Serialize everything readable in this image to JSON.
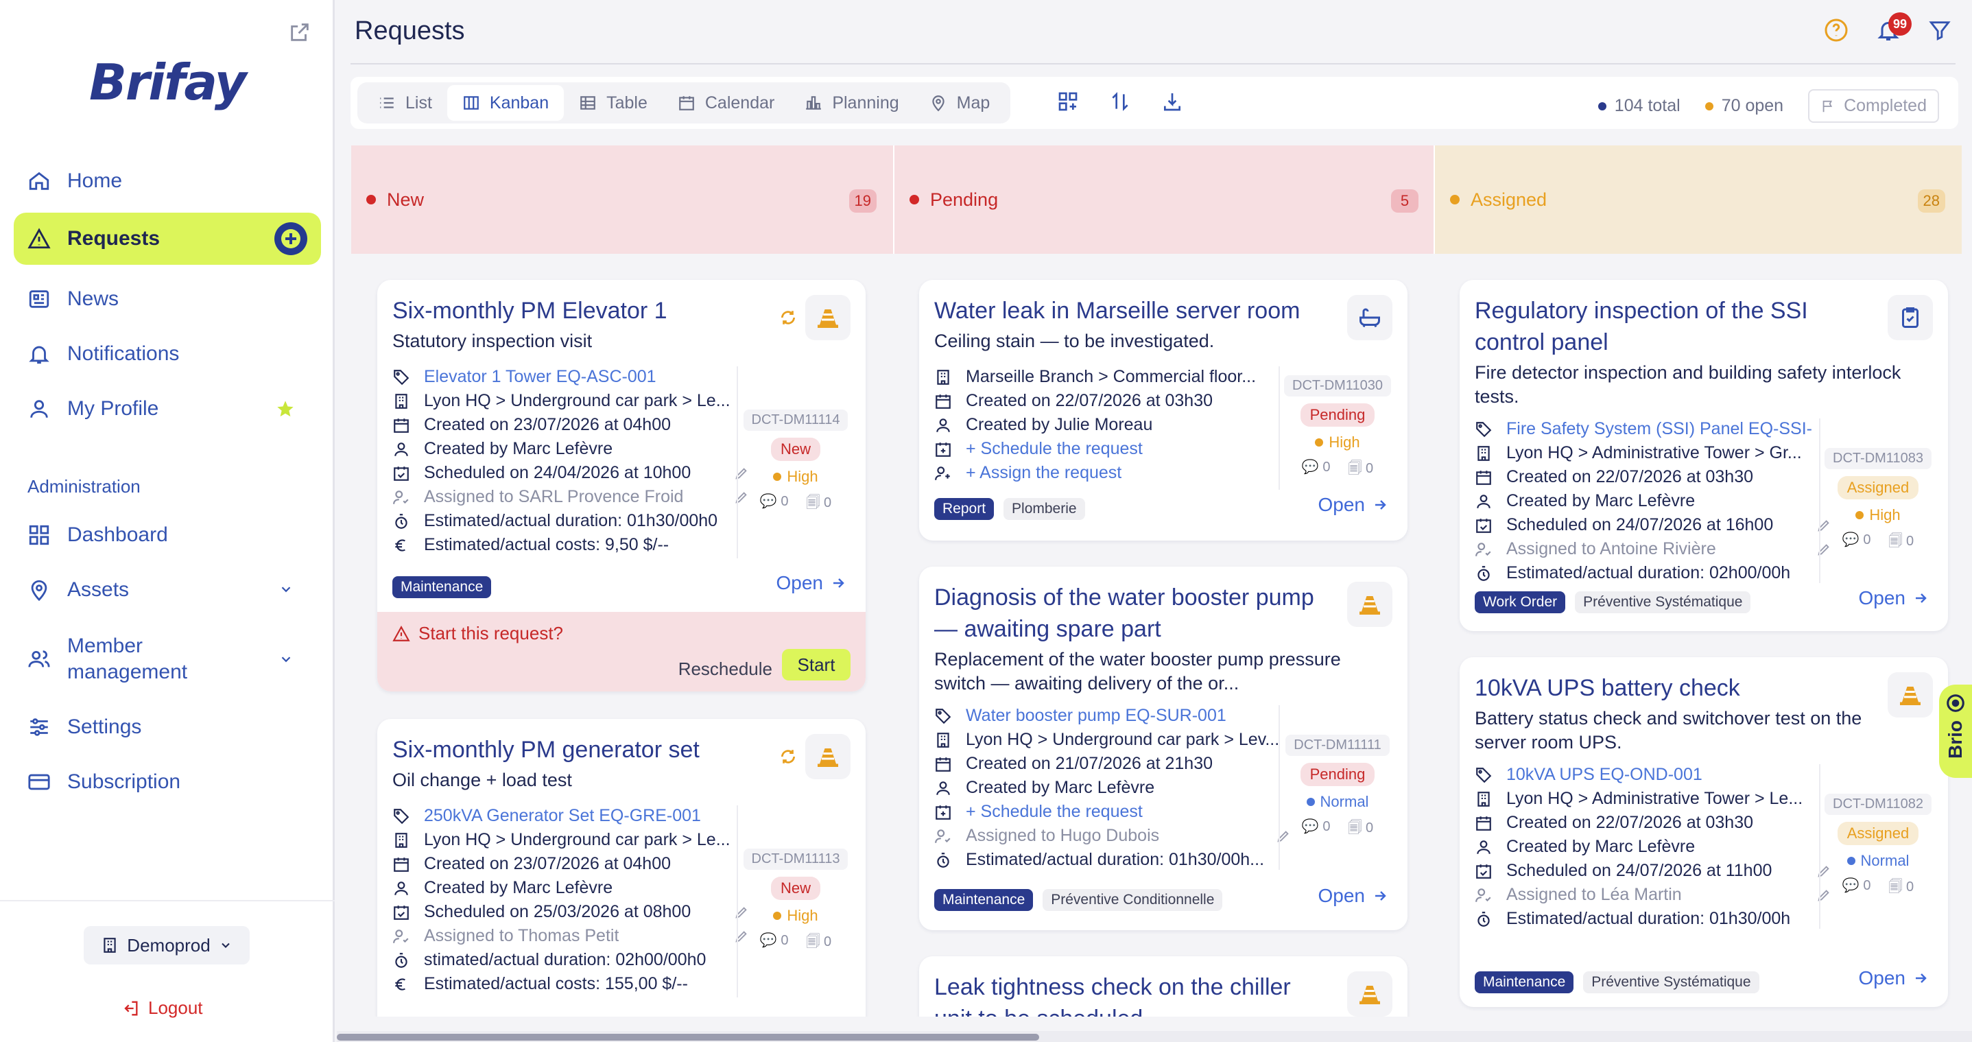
{
  "sidebar": {
    "logo": "Brifay",
    "nav": [
      {
        "label": "Home"
      },
      {
        "label": "Requests"
      },
      {
        "label": "News"
      },
      {
        "label": "Notifications"
      },
      {
        "label": "My Profile"
      }
    ],
    "admin_heading": "Administration",
    "admin_nav": [
      {
        "label": "Dashboard"
      },
      {
        "label": "Assets"
      },
      {
        "label": "Member management"
      },
      {
        "label": "Settings"
      },
      {
        "label": "Subscription"
      }
    ],
    "org": "Demoprod",
    "logout": "Logout"
  },
  "header": {
    "title": "Requests",
    "notif_count": "99"
  },
  "toolbar": {
    "views": [
      "List",
      "Kanban",
      "Table",
      "Calendar",
      "Planning",
      "Map"
    ],
    "active_view": "Kanban",
    "total": "104 total",
    "open": "70 open",
    "completed": "Completed"
  },
  "colors": {
    "accent": "#dcf55a",
    "brand": "#2a3a8c",
    "new": "#d32828",
    "assigned": "#e8a020"
  },
  "columns": [
    {
      "name": "New",
      "count": "19",
      "cards": [
        {
          "title": "Six-monthly PM Elevator 1",
          "subtitle": "Statutory inspection visit",
          "asset": "Elevator 1 Tower EQ-ASC-001",
          "location": "Lyon HQ > Underground car park > Le...",
          "created_on": "Created on 23/07/2026 at 04h00",
          "created_by": "Created by Marc Lefèvre",
          "scheduled": "Scheduled on 24/04/2026 at 10h00",
          "assigned": "Assigned to SARL Provence Froid",
          "duration": "Estimated/actual duration: 01h30/00h0",
          "costs": "Estimated/actual costs: 9,50 $/--",
          "ref": "DCT-DM11114",
          "status": "New",
          "priority": "High",
          "comments": "0",
          "attachments": "0",
          "tags": [
            "Maintenance"
          ],
          "open": "Open",
          "start_question": "Start this request?",
          "reschedule": "Reschedule",
          "start": "Start"
        },
        {
          "title": "Six-monthly PM generator set",
          "subtitle": "Oil change + load test",
          "asset": "250kVA Generator Set EQ-GRE-001",
          "location": "Lyon HQ > Underground car park > Le...",
          "created_on": "Created on 23/07/2026 at 04h00",
          "created_by": "Created by Marc Lefèvre",
          "scheduled": "Scheduled on 25/03/2026 at 08h00",
          "assigned": "Assigned to Thomas Petit",
          "duration": "stimated/actual duration: 02h00/00h0",
          "costs": "Estimated/actual costs: 155,00 $/--",
          "ref": "DCT-DM11113",
          "status": "New",
          "priority": "High",
          "comments": "0",
          "attachments": "0",
          "open": "Open"
        }
      ]
    },
    {
      "name": "Pending",
      "count": "5",
      "cards": [
        {
          "title": "Water leak in Marseille server room",
          "subtitle": "Ceiling stain — to be investigated.",
          "location": "Marseille Branch > Commercial floor...",
          "created_on": "Created on 22/07/2026 at 03h30",
          "created_by": "Created by Julie Moreau",
          "schedule_action": "+ Schedule the request",
          "assign_action": "+ Assign the request",
          "ref": "DCT-DM11030",
          "status": "Pending",
          "priority": "High",
          "comments": "0",
          "attachments": "0",
          "tags": [
            "Report",
            "Plomberie"
          ],
          "open": "Open"
        },
        {
          "title": "Diagnosis of the water booster pump — awaiting spare part",
          "subtitle": "Replacement of the water booster pump pressure switch — awaiting delivery of the or...",
          "asset": "Water booster pump EQ-SUR-001",
          "location": "Lyon HQ > Underground car park > Lev...",
          "created_on": "Created on 21/07/2026 at 21h30",
          "created_by": "Created by Marc Lefèvre",
          "schedule_action": "+ Schedule the request",
          "assigned": "Assigned to Hugo Dubois",
          "duration": "Estimated/actual duration: 01h30/00h...",
          "ref": "DCT-DM11111",
          "status": "Pending",
          "priority": "Normal",
          "comments": "0",
          "attachments": "0",
          "tags": [
            "Maintenance",
            "Préventive Conditionnelle"
          ],
          "open": "Open"
        },
        {
          "title": "Leak tightness check on the chiller unit to be scheduled"
        }
      ]
    },
    {
      "name": "Assigned",
      "count": "28",
      "cards": [
        {
          "title": "Regulatory inspection of the SSI control panel",
          "subtitle": "Fire detector inspection and building safety interlock tests.",
          "asset": "Fire Safety System (SSI) Panel EQ-SSI-",
          "location": "Lyon HQ > Administrative Tower > Gr...",
          "created_on": "Created on 22/07/2026 at 03h30",
          "created_by": "Created by Marc Lefèvre",
          "scheduled": "Scheduled on 24/07/2026 at 16h00",
          "assigned": "Assigned to Antoine Rivière",
          "duration": "Estimated/actual duration: 02h00/00h",
          "ref": "DCT-DM11083",
          "status": "Assigned",
          "priority": "High",
          "comments": "0",
          "attachments": "0",
          "tags": [
            "Work Order",
            "Préventive Systématique"
          ],
          "open": "Open"
        },
        {
          "title": "10kVA UPS battery check",
          "subtitle": "Battery status check and switchover test on the server room UPS.",
          "asset": "10kVA UPS EQ-OND-001",
          "location": "Lyon HQ > Administrative Tower > Le...",
          "created_on": "Created on 22/07/2026 at 03h30",
          "created_by": "Created by Marc Lefèvre",
          "scheduled": "Scheduled on 24/07/2026 at 11h00",
          "assigned": "Assigned to Léa Martin",
          "duration": "Estimated/actual duration: 01h30/00h",
          "ref": "DCT-DM11082",
          "status": "Assigned",
          "priority": "Normal",
          "comments": "0",
          "attachments": "0",
          "tags": [
            "Maintenance",
            "Préventive Systématique"
          ],
          "open": "Open"
        }
      ]
    }
  ],
  "brio": "Brio"
}
